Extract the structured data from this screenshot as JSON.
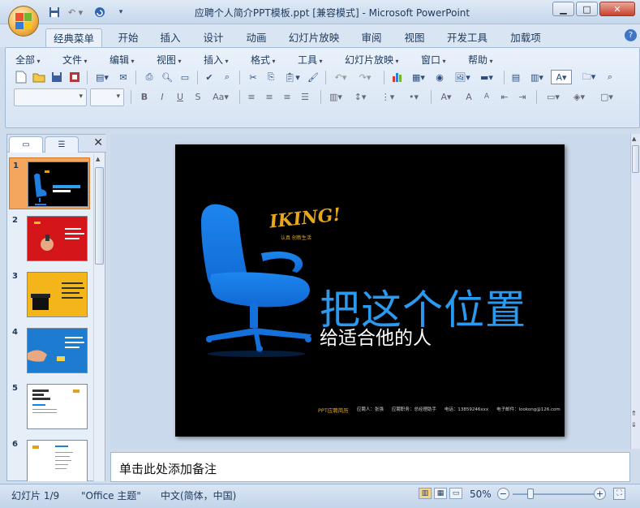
{
  "app": {
    "title": "应聘个人简介PPT模板.ppt [兼容模式] - Microsoft PowerPoint",
    "colors": {
      "chrome": "#d9e5f3",
      "accent_blue": "#1f7fe0",
      "selection": "#f3a65c",
      "slide_bg": "#000000"
    }
  },
  "quick_access": {
    "icons": [
      "save-icon",
      "undo-icon",
      "redo-icon",
      "customize-icon"
    ]
  },
  "ribbon_tabs": [
    {
      "label": "经典菜单",
      "active": true
    },
    {
      "label": "开始"
    },
    {
      "label": "插入"
    },
    {
      "label": "设计"
    },
    {
      "label": "动画"
    },
    {
      "label": "幻灯片放映"
    },
    {
      "label": "审阅"
    },
    {
      "label": "视图"
    },
    {
      "label": "开发工具"
    },
    {
      "label": "加载项"
    }
  ],
  "classic_menu": [
    "全部",
    "文件",
    "编辑",
    "视图",
    "插入",
    "格式",
    "工具",
    "幻灯片放映",
    "窗口",
    "帮助"
  ],
  "slides": [
    {
      "number": "1"
    },
    {
      "number": "2"
    },
    {
      "number": "3"
    },
    {
      "number": "4"
    },
    {
      "number": "5"
    },
    {
      "number": "6"
    }
  ],
  "current_slide": {
    "logo": "IKING!",
    "logo_sub": "认真 创新生活",
    "title": "把这个位置",
    "subtitle": "给适合他的人",
    "footer": {
      "brand": "PPT应聘简历",
      "items": [
        "应聘人：张强",
        "应聘职务：总经理助手",
        "电话：13859246xxx",
        "电子邮件：lookong@126.com"
      ]
    }
  },
  "notes": {
    "placeholder": "单击此处添加备注"
  },
  "status_bar": {
    "slide_info": "幻灯片 1/9",
    "theme": "\"Office 主题\"",
    "language": "中文(简体，中国)",
    "zoom": "50%",
    "zoom_level": 0.5
  }
}
